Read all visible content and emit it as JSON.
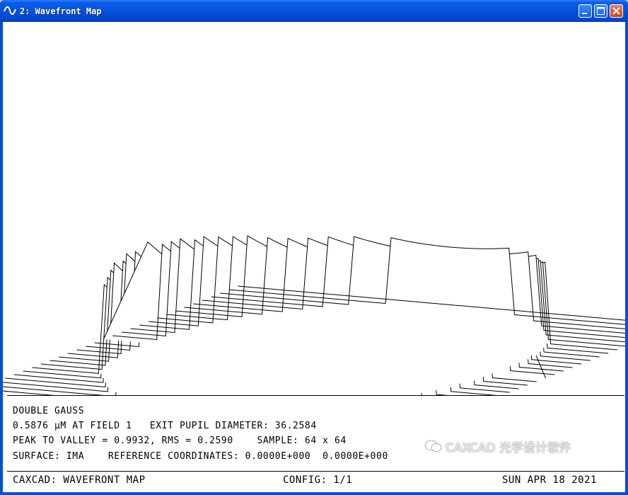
{
  "window": {
    "title": "2: Wavefront Map"
  },
  "title_buttons": {
    "minimize": "minimize",
    "maximize": "maximize",
    "close": "close"
  },
  "info": {
    "line1": "DOUBLE GAUSS",
    "line2": "0.5876 µM AT FIELD 1   EXIT PUPIL DIAMETER: 36.2584",
    "line3": "PEAK TO VALLEY = 0.9932, RMS = 0.2590    SAMPLE: 64 x 64",
    "line4": "SURFACE: IMA    REFERENCE COORDINATES: 0.0000E+000  0.0000E+000"
  },
  "status": {
    "left": "CAXCAD: WAVEFRONT MAP",
    "middle": "CONFIG: 1/1",
    "right": "SUN APR 18 2021"
  },
  "watermark": {
    "text": "CAXCAD 光学设计软件"
  },
  "icons": {
    "app": "wave-icon",
    "watermark": "wechat-icon"
  }
}
